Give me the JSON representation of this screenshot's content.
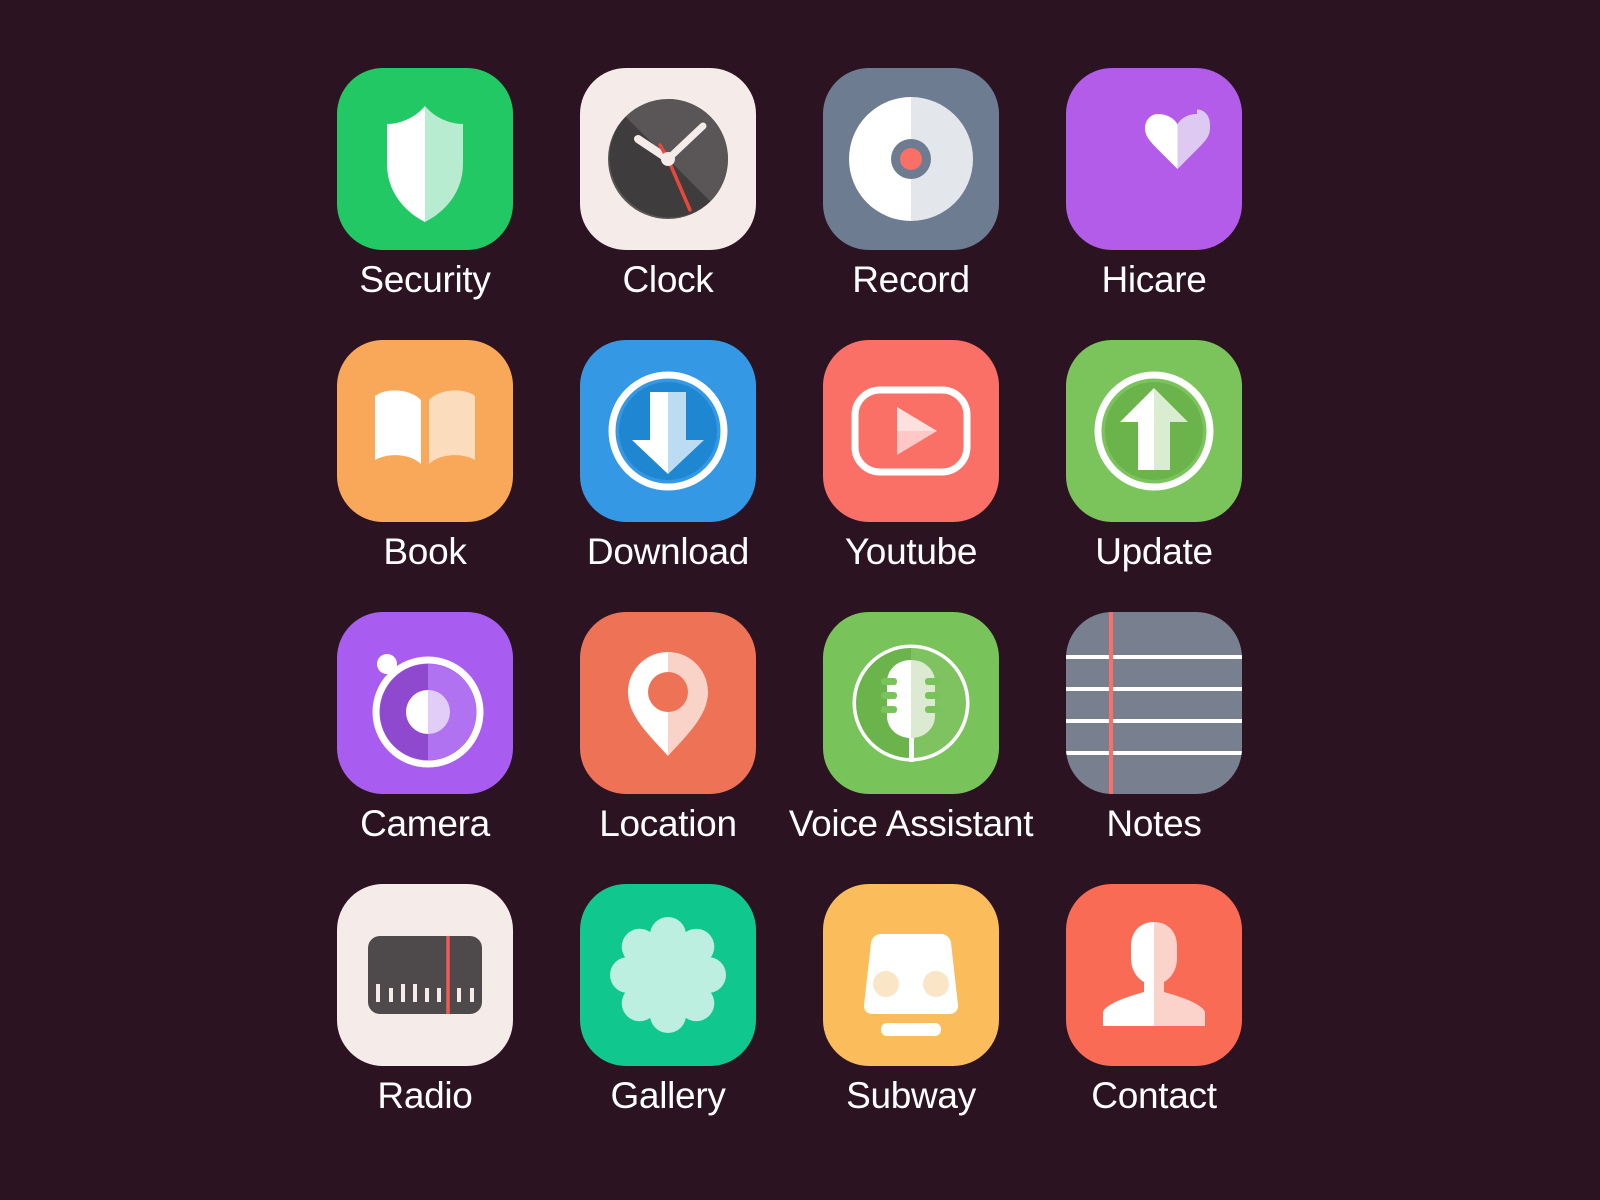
{
  "screen": {
    "background_color": "#2b1321",
    "label_color": "#ffffff",
    "columns": 4,
    "rows": 4,
    "app_count": 16
  },
  "apps": [
    {
      "label": "Security",
      "icon": "shield-icon",
      "tile_color": "#21c863",
      "accent_color": "#ffffff"
    },
    {
      "label": "Clock",
      "icon": "analog-clock-icon",
      "tile_color": "#f5ebe9",
      "accent_color": "#4e4a4b"
    },
    {
      "label": "Record",
      "icon": "vinyl-disc-icon",
      "tile_color": "#6d7c90",
      "accent_color": "#ffffff"
    },
    {
      "label": "Hicare",
      "icon": "heart-icon",
      "tile_color": "#b45cea",
      "accent_color": "#ffffff"
    },
    {
      "label": "Book",
      "icon": "open-book-icon",
      "tile_color": "#f9a758",
      "accent_color": "#ffffff"
    },
    {
      "label": "Download",
      "icon": "download-arrow-icon",
      "tile_color": "#3498e4",
      "accent_color": "#ffffff"
    },
    {
      "label": "Youtube",
      "icon": "play-button-icon",
      "tile_color": "#fa6f66",
      "accent_color": "#ffffff"
    },
    {
      "label": "Update",
      "icon": "upload-arrow-icon",
      "tile_color": "#7bc45c",
      "accent_color": "#ffffff"
    },
    {
      "label": "Camera",
      "icon": "camera-lens-icon",
      "tile_color": "#a95df0",
      "accent_color": "#ffffff"
    },
    {
      "label": "Location",
      "icon": "map-pin-icon",
      "tile_color": "#ee7255",
      "accent_color": "#ffffff"
    },
    {
      "label": "Voice Assistant",
      "icon": "microphone-icon",
      "tile_color": "#79c45a",
      "accent_color": "#ffffff"
    },
    {
      "label": "Notes",
      "icon": "ruled-paper-icon",
      "tile_color": "#78808f",
      "accent_color": "#ffffff"
    },
    {
      "label": "Radio",
      "icon": "radio-dial-icon",
      "tile_color": "#f5ebe9",
      "accent_color": "#4e4a4b"
    },
    {
      "label": "Gallery",
      "icon": "flower-petals-icon",
      "tile_color": "#10c78d",
      "accent_color": "#ffffff"
    },
    {
      "label": "Subway",
      "icon": "train-front-icon",
      "tile_color": "#fbbc5c",
      "accent_color": "#ffffff"
    },
    {
      "label": "Contact",
      "icon": "person-bust-icon",
      "tile_color": "#fa6b55",
      "accent_color": "#ffffff"
    }
  ]
}
